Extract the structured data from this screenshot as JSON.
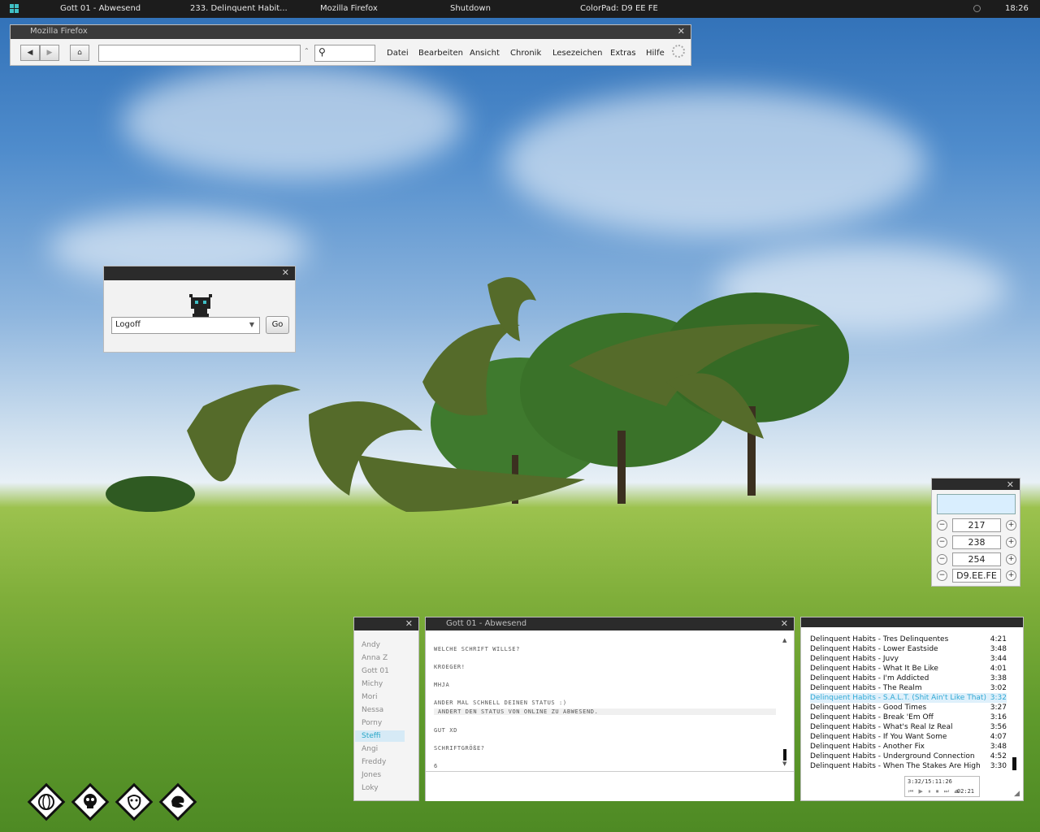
{
  "taskbar": {
    "items": [
      "Gott 01 - Abwesend",
      "233. Delinquent Habit...",
      "Mozilla Firefox",
      "Shutdown",
      "ColorPad: D9 EE FE"
    ],
    "clock": "18:26"
  },
  "firefox": {
    "title": "Mozilla Firefox",
    "url_value": "",
    "search_value": "",
    "menu": [
      "Datei",
      "Bearbeiten",
      "Ansicht",
      "Chronik",
      "Lesezeichen",
      "Extras",
      "Hilfe"
    ]
  },
  "logoff": {
    "selected": "Logoff",
    "go_label": "Go"
  },
  "colorpad": {
    "color": "#D9EEFE",
    "r": "217",
    "g": "238",
    "b": "254",
    "hex": "D9.EE.FE",
    "minus": "−",
    "plus": "+"
  },
  "buddies": [
    "Andy",
    "Anna Z",
    "Gott 01",
    "Michy",
    "Mori",
    "Nessa",
    "Porny",
    "Steffi",
    "Angi",
    "Freddy",
    "Jones",
    "Loky"
  ],
  "buddies_selected": "Steffi",
  "chat": {
    "title": "Gott 01 - Abwesend",
    "messages": [
      "WELCHE SCHRIFT WILLSE?",
      "KROEGER!",
      "MHJA",
      "ANDER MAL SCHNELL DEINEN STATUS :)",
      "ANDERT DEN STATUS VON ONLINE ZU ABWESEND.",
      "GUT XD",
      "SCHRIFTGRÖßE?",
      "6"
    ]
  },
  "playlist": {
    "tracks": [
      {
        "title": "Delinquent Habits - Tres Delinquentes",
        "duration": "4:21"
      },
      {
        "title": "Delinquent Habits - Lower Eastside",
        "duration": "3:48"
      },
      {
        "title": "Delinquent Habits - Juvy",
        "duration": "3:44"
      },
      {
        "title": "Delinquent Habits - What It Be Like",
        "duration": "4:01"
      },
      {
        "title": "Delinquent Habits - I'm Addicted",
        "duration": "3:38"
      },
      {
        "title": "Delinquent Habits - The Realm",
        "duration": "3:02"
      },
      {
        "title": "Delinquent Habits - S.A.L.T. (Shit Ain't Like That)",
        "duration": "3:32"
      },
      {
        "title": "Delinquent Habits - Good Times",
        "duration": "3:27"
      },
      {
        "title": "Delinquent Habits - Break 'Em Off",
        "duration": "3:16"
      },
      {
        "title": "Delinquent Habits - What's Real Iz Real",
        "duration": "3:56"
      },
      {
        "title": "Delinquent Habits - If You Want Some",
        "duration": "4:07"
      },
      {
        "title": "Delinquent Habits - Another Fix",
        "duration": "3:48"
      },
      {
        "title": "Delinquent Habits - Underground Connection",
        "duration": "4:52"
      },
      {
        "title": "Delinquent Habits - When The Stakes Are High",
        "duration": "3:30"
      }
    ],
    "active_index": 6,
    "player_status": "3:32/15:11:26",
    "player_controls": "⏮ ▶ ⏸ ⏹ ⏭ ⏏",
    "elapsed": "02:21"
  },
  "colors": {
    "accent": "#3fc0c6",
    "taskbar": "#1c1c1c",
    "titlebar": "#2b2b2b"
  },
  "dock_icons": [
    "globe-icon",
    "skull-icon",
    "face-icon",
    "hand-icon"
  ]
}
